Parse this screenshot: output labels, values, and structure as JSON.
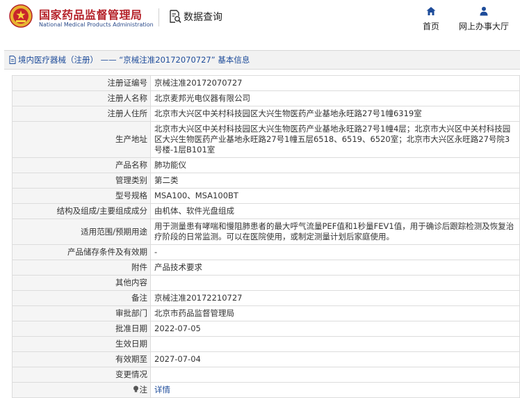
{
  "header": {
    "org_name_cn": "国家药品监督管理局",
    "org_name_en": "National Medical Products Administration",
    "query_title": "数据查询",
    "nav": [
      {
        "label": "首页",
        "icon": "home-icon"
      },
      {
        "label": "网上办事大厅",
        "icon": "user-icon"
      }
    ]
  },
  "breadcrumb": {
    "text": "境内医疗器械（注册） —— “京械注准20172070727” 基本信息"
  },
  "record": {
    "rows": [
      {
        "label": "注册证编号",
        "value": "京械注准20172070727"
      },
      {
        "label": "注册人名称",
        "value": "北京麦邦光电仪器有限公司"
      },
      {
        "label": "注册人住所",
        "value": "北京市大兴区中关村科技园区大兴生物医药产业基地永旺路27号1幢6319室"
      },
      {
        "label": "生产地址",
        "value": "北京市大兴区中关村科技园区大兴生物医药产业基地永旺路27号1幢4层；北京市大兴区中关村科技园区大兴生物医药产业基地永旺路27号1幢五层6518、6519、6520室；北京市大兴区永旺路27号院3号楼-1层B101室"
      },
      {
        "label": "产品名称",
        "value": "肺功能仪"
      },
      {
        "label": "管理类别",
        "value": "第二类"
      },
      {
        "label": "型号规格",
        "value": "MSA100、MSA100BT"
      },
      {
        "label": "结构及组成/主要组成成分",
        "value": "由机体、软件光盘组成"
      },
      {
        "label": "适用范围/预期用途",
        "value": "用于测量患有哮喘和慢阻肺患者的最大呼气流量PEF值和1秒量FEV1值，用于确诊后跟踪检测及恢复治疗阶段的日常监测。可以在医院使用，或制定测量计划后家庭使用。"
      },
      {
        "label": "产品储存条件及有效期",
        "value": "-"
      },
      {
        "label": "附件",
        "value": "产品技术要求"
      },
      {
        "label": "其他内容",
        "value": ""
      },
      {
        "label": "备注",
        "value": "京械注准20172210727"
      },
      {
        "label": "审批部门",
        "value": "北京市药品监督管理局"
      },
      {
        "label": "批准日期",
        "value": "2022-07-05"
      },
      {
        "label": "生效日期",
        "value": ""
      },
      {
        "label": "有效期至",
        "value": "2027-07-04"
      },
      {
        "label": "变更情况",
        "value": ""
      }
    ],
    "note_label": "注",
    "note_link": "详情"
  },
  "colors": {
    "brand_red": "#b5222a",
    "link_blue": "#1e4c9a",
    "label_bg": "#f5f5f5",
    "border": "#dcdcdc"
  }
}
